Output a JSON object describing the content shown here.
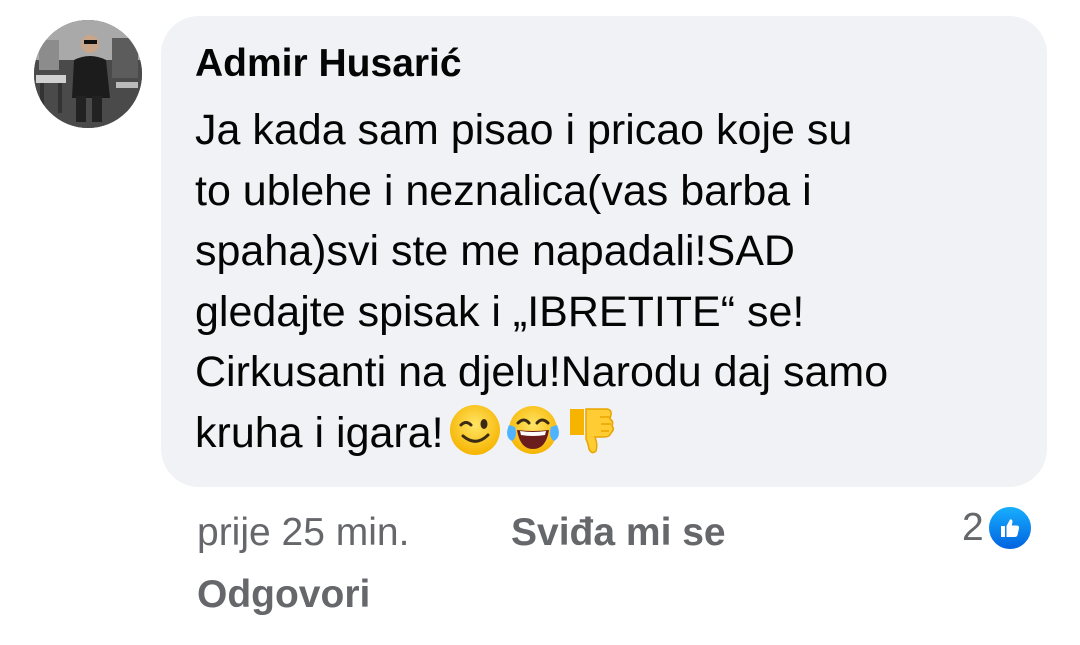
{
  "comment": {
    "author": "Admir Husarić",
    "lines": [
      "Ja kada sam pisao i pricao koje su",
      "to ublehe i neznalica(vas barba i",
      "spaha)svi ste me napadali!SAD",
      "gledajte spisak i „IBRETITE“ se!",
      "Cirkusanti na djelu!Narodu daj samo",
      "kruha i igara!"
    ],
    "emojis": [
      "winking-face-icon",
      "face-with-tears-of-joy-icon",
      "thumbs-down-icon"
    ]
  },
  "meta": {
    "time": "prije 25 min.",
    "like_label": "Sviđa mi se",
    "reply_label": "Odgovori",
    "reaction_count": "2"
  },
  "colors": {
    "bubble": "#f0f2f5",
    "meta_text": "#65676b",
    "like_blue": "#0866ff"
  }
}
